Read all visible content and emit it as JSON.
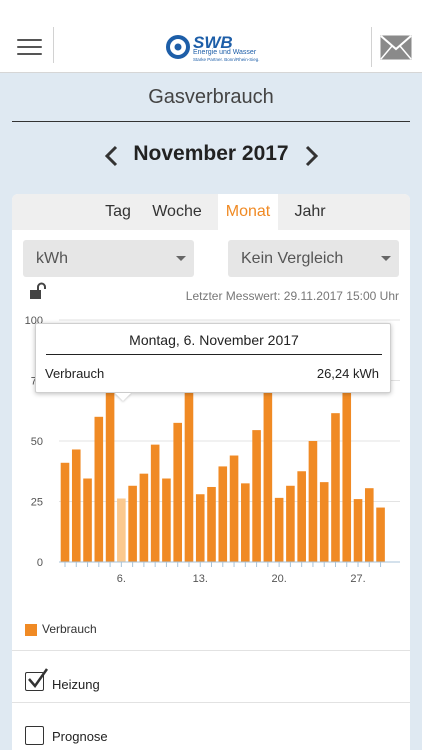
{
  "header": {
    "logo_text": "SWB",
    "logo_sub1": "Energie und Wasser",
    "logo_sub2": "Starke Partner. Bonn/Rhein-Sieg.",
    "menu_icon": "hamburger-icon",
    "mail_icon": "mail-icon"
  },
  "page": {
    "title": "Gasverbrauch",
    "month": "November 2017"
  },
  "tabs": [
    {
      "label": "Tag",
      "active": false
    },
    {
      "label": "Woche",
      "active": false
    },
    {
      "label": "Monat",
      "active": true
    },
    {
      "label": "Jahr",
      "active": false
    }
  ],
  "controls": {
    "unit_value": "kWh",
    "compare_value": "Kein Vergleich",
    "last_reading": "Letzter Messwert: 29.11.2017 15:00 Uhr"
  },
  "tooltip": {
    "date": "Montag, 6. November 2017",
    "label": "Verbrauch",
    "value": "26,24 kWh"
  },
  "chart_data": {
    "type": "bar",
    "categories": [
      "1",
      "2",
      "3",
      "4",
      "5",
      "6",
      "7",
      "8",
      "9",
      "10",
      "11",
      "12",
      "13",
      "14",
      "15",
      "16",
      "17",
      "18",
      "19",
      "20",
      "21",
      "22",
      "23",
      "24",
      "25",
      "26",
      "27",
      "28",
      "29"
    ],
    "series": [
      {
        "name": "Verbrauch",
        "values": [
          41,
          46.5,
          34.5,
          60,
          72,
          26.24,
          31.5,
          36.5,
          48.5,
          34.5,
          57.5,
          72,
          28,
          31,
          39.5,
          44,
          32.5,
          54.5,
          77,
          26.5,
          31.5,
          37.5,
          50,
          33,
          61.5,
          74.5,
          26,
          30.5,
          22.5
        ]
      }
    ],
    "x_tick_labels": [
      "6.",
      "13.",
      "20.",
      "27."
    ],
    "x_tick_label_days": [
      6,
      13,
      20,
      27
    ],
    "y_ticks": [
      0,
      25,
      50,
      75,
      100
    ],
    "ylim": [
      0,
      100
    ],
    "highlighted_day": 6,
    "grid": true,
    "bar_color": "#f08a24",
    "highlight_color": "#fbc98e"
  },
  "legend": {
    "label": "Verbrauch",
    "color": "#f08a24"
  },
  "options": [
    {
      "label": "Heizung",
      "checked": true
    },
    {
      "label": "Prognose",
      "checked": false
    }
  ]
}
